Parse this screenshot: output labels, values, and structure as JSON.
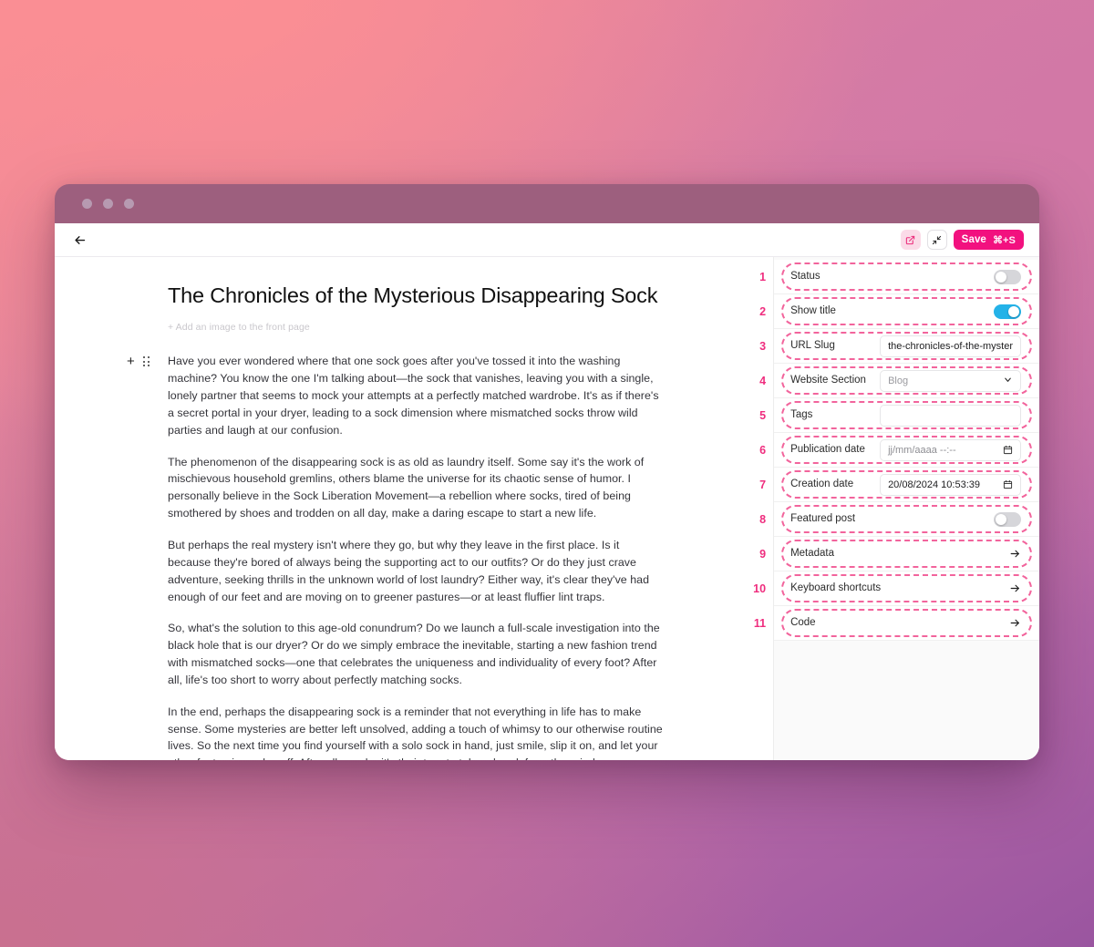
{
  "window": {
    "traffic_lights": [
      "close",
      "minimize",
      "maximize"
    ]
  },
  "toolbar": {
    "back_label": "←",
    "open_external_icon": "external-link-icon",
    "collapse_icon": "collapse-icon",
    "save_label": "Save",
    "save_shortcut": "⌘+S"
  },
  "document": {
    "title": "The Chronicles of the Mysterious Disappearing Sock",
    "add_image_label": "+ Add an image to the front page",
    "paragraphs": [
      "Have you ever wondered where that one sock goes after you've tossed it into the washing machine? You know the one I'm talking about—the sock that vanishes, leaving you with a single, lonely partner that seems to mock your attempts at a perfectly matched wardrobe. It's as if there's a secret portal in your dryer, leading to a sock dimension where mismatched socks throw wild parties and laugh at our confusion.",
      "The phenomenon of the disappearing sock is as old as laundry itself. Some say it's the work of mischievous household gremlins, others blame the universe for its chaotic sense of humor. I personally believe in the Sock Liberation Movement—a rebellion where socks, tired of being smothered by shoes and trodden on all day, make a daring escape to start a new life.",
      "But perhaps the real mystery isn't where they go, but why they leave in the first place. Is it because they're bored of always being the supporting act to our outfits? Or do they just crave adventure, seeking thrills in the unknown world of lost laundry? Either way, it's clear they've had enough of our feet and are moving on to greener pastures—or at least fluffier lint traps.",
      "So, what's the solution to this age-old conundrum? Do we launch a full-scale investigation into the black hole that is our dryer? Or do we simply embrace the inevitable, starting a new fashion trend with mismatched socks—one that celebrates the uniqueness and individuality of every foot? After all, life's too short to worry about perfectly matching socks.",
      "In the end, perhaps the disappearing sock is a reminder that not everything in life has to make sense. Some mysteries are better left unsolved, adding a touch of whimsy to our otherwise routine lives. So the next time you find yourself with a solo sock in hand, just smile, slip it on, and let your other foot enjoy a day off. After all, maybe it's their turn to take a break from the grind."
    ]
  },
  "sidebar": {
    "rows": [
      {
        "number": "1",
        "label": "Status",
        "control": "toggle",
        "toggle_on": false
      },
      {
        "number": "2",
        "label": "Show title",
        "control": "toggle",
        "toggle_on": true
      },
      {
        "number": "3",
        "label": "URL Slug",
        "control": "text",
        "value": "the-chronicles-of-the-myster",
        "placeholder": ""
      },
      {
        "number": "4",
        "label": "Website Section",
        "control": "select",
        "value": "Blog"
      },
      {
        "number": "5",
        "label": "Tags",
        "control": "text",
        "value": "",
        "placeholder": ""
      },
      {
        "number": "6",
        "label": "Publication date",
        "control": "datetime",
        "value": "",
        "placeholder": "jj/mm/aaaa --:--"
      },
      {
        "number": "7",
        "label": "Creation date",
        "control": "datetime",
        "value": "20/08/2024 10:53:39",
        "placeholder": ""
      },
      {
        "number": "8",
        "label": "Featured post",
        "control": "toggle",
        "toggle_on": false
      },
      {
        "number": "9",
        "label": "Metadata",
        "control": "arrow"
      },
      {
        "number": "10",
        "label": "Keyboard shortcuts",
        "control": "arrow"
      },
      {
        "number": "11",
        "label": "Code",
        "control": "arrow"
      }
    ]
  },
  "colors": {
    "accent_pink": "#f2117f",
    "annotation_pink": "#ef2d7e",
    "dashed_outline": "#f2649c",
    "toggle_on": "#24b2e8"
  }
}
